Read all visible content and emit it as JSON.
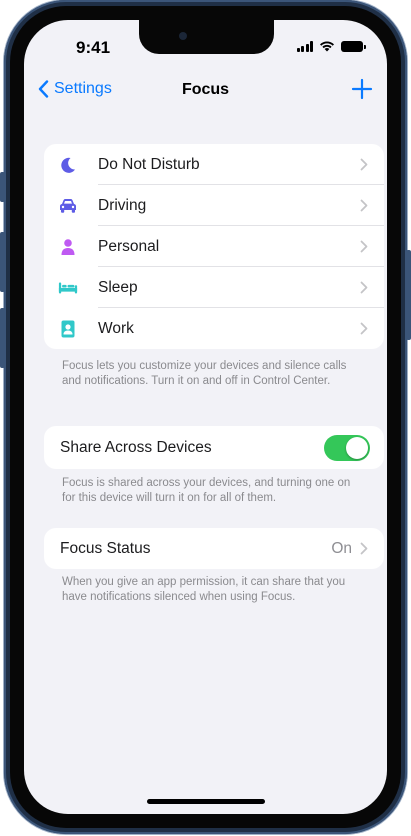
{
  "status_bar": {
    "time": "9:41"
  },
  "nav": {
    "back_label": "Settings",
    "title": "Focus",
    "add_icon": "plus-icon"
  },
  "focus_modes": [
    {
      "label": "Do Not Disturb",
      "icon": "moon-icon",
      "color": "#5e5ce6"
    },
    {
      "label": "Driving",
      "icon": "car-icon",
      "color": "#5e5ce6"
    },
    {
      "label": "Personal",
      "icon": "person-icon",
      "color": "#bf5af2"
    },
    {
      "label": "Sleep",
      "icon": "bed-icon",
      "color": "#30c8c9"
    },
    {
      "label": "Work",
      "icon": "badge-icon",
      "color": "#30c8c9"
    }
  ],
  "focus_footnote": "Focus lets you customize your devices and silence calls and notifications. Turn it on and off in Control Center.",
  "share": {
    "label": "Share Across Devices",
    "enabled": true,
    "footnote": "Focus is shared across your devices, and turning one on for this device will turn it on for all of them."
  },
  "status": {
    "label": "Focus Status",
    "value": "On",
    "footnote": "When you give an app permission, it can share that you have notifications silenced when using Focus."
  },
  "colors": {
    "accent": "#0a7aff",
    "toggle_on": "#34c759",
    "background": "#f2f2f7"
  }
}
